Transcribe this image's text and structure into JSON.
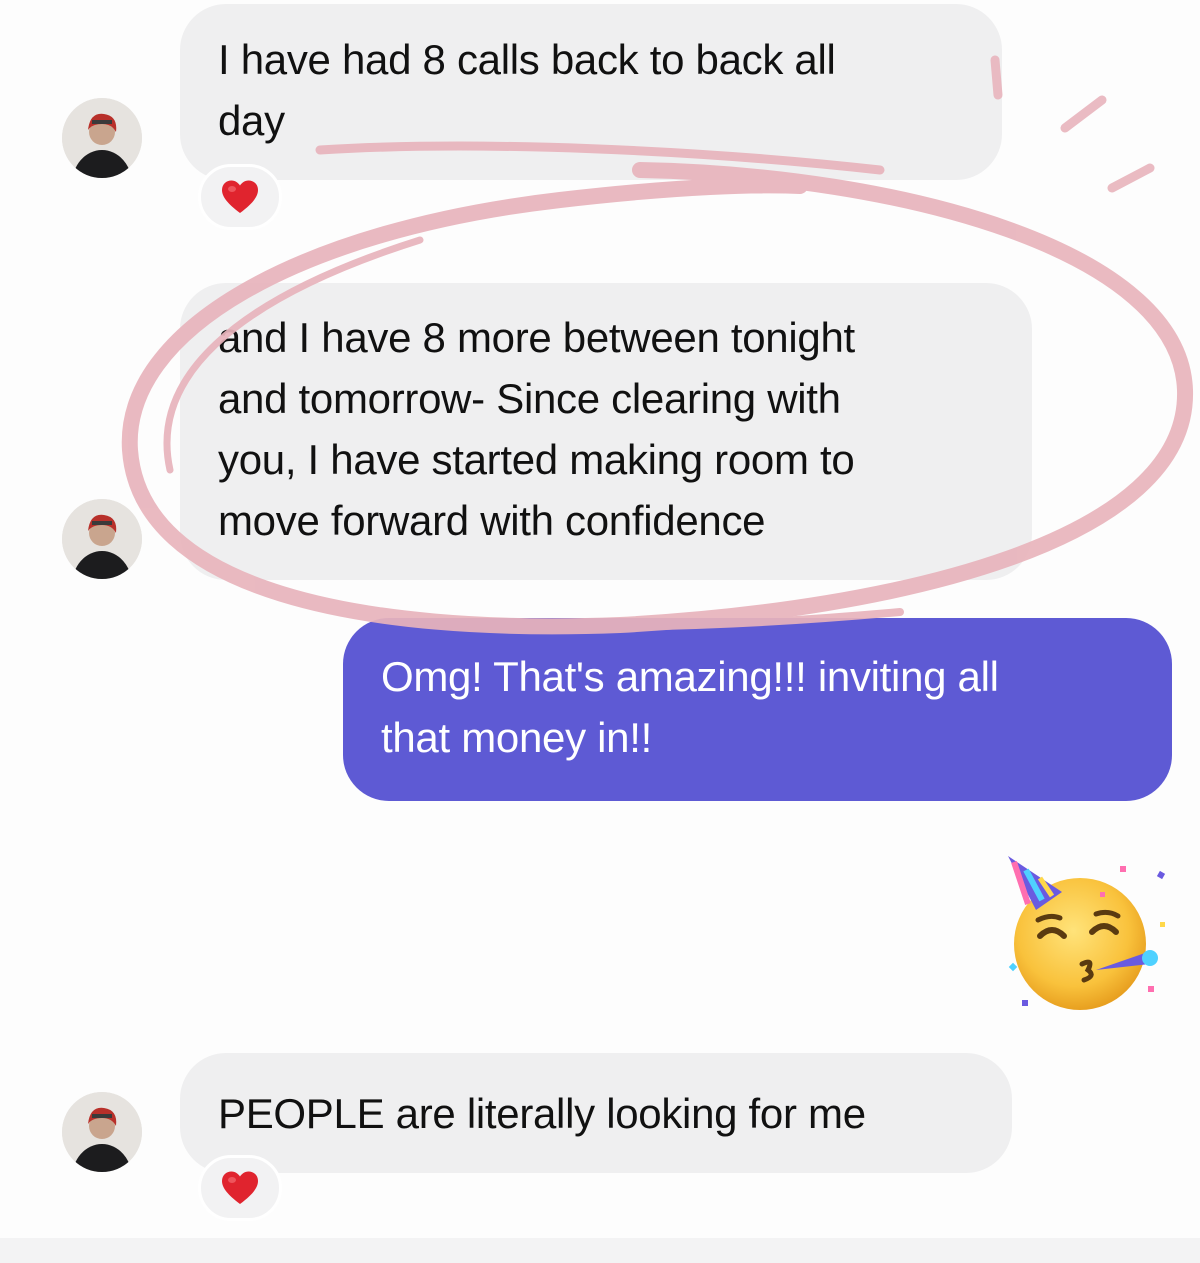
{
  "messages": [
    {
      "direction": "incoming",
      "lines": [
        "I have had 8 calls back to back all",
        "day"
      ],
      "reaction": "red-heart"
    },
    {
      "direction": "incoming",
      "lines": [
        "and I have 8 more between tonight",
        "and tomorrow- Since clearing with",
        "you, I have started making room to",
        "move forward with confidence"
      ],
      "highlighted": true
    },
    {
      "direction": "outgoing",
      "lines": [
        "Omg! That's amazing!!! inviting all",
        "that money in!!"
      ]
    },
    {
      "direction": "outgoing",
      "emoji": "partying-face"
    },
    {
      "direction": "incoming",
      "lines": [
        "PEOPLE are literally looking for me"
      ],
      "reaction": "red-heart"
    }
  ],
  "colors": {
    "incoming_bubble": "#efeff0",
    "outgoing_bubble": "#5e5ad4",
    "highlight_circle": "#e8b4bc",
    "heart": "#e0242e"
  }
}
